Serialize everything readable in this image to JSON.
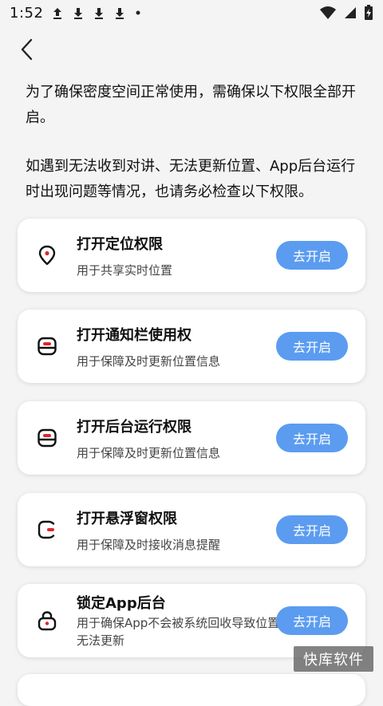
{
  "status_bar": {
    "time": "1:52",
    "icons": [
      "upload-icon",
      "download-icon",
      "download-icon",
      "download-icon",
      "dot-icon",
      "wifi-icon",
      "battery-charging-icon"
    ]
  },
  "nav": {
    "back_icon": "chevron-left-icon"
  },
  "intro": {
    "paragraph1": "为了确保密度空间正常使用，需确保以下权限全部开启。",
    "paragraph2": "如遇到无法收到对讲、无法更新位置、App后台运行时出现问题等情况，也请务必检查以下权限。"
  },
  "permissions": [
    {
      "icon": "location-pin-icon",
      "title": "打开定位权限",
      "subtitle": "用于共享实时位置",
      "button": "去开启"
    },
    {
      "icon": "notification-bar-icon",
      "title": "打开通知栏使用权",
      "subtitle": "用于保障及时更新位置信息",
      "button": "去开启"
    },
    {
      "icon": "background-run-icon",
      "title": "打开后台运行权限",
      "subtitle": "用于保障及时更新位置信息",
      "button": "去开启"
    },
    {
      "icon": "floating-window-icon",
      "title": "打开悬浮窗权限",
      "subtitle": "用于保障及时接收消息提醒",
      "button": "去开启"
    },
    {
      "icon": "lock-icon",
      "title": "锁定App后台",
      "subtitle": "用于确保App不会被系统回收导致位置无法更新",
      "button": "去开启"
    }
  ],
  "colors": {
    "accent": "#5b9cf0",
    "icon_red": "#e0262b"
  },
  "watermark": "快库软件"
}
